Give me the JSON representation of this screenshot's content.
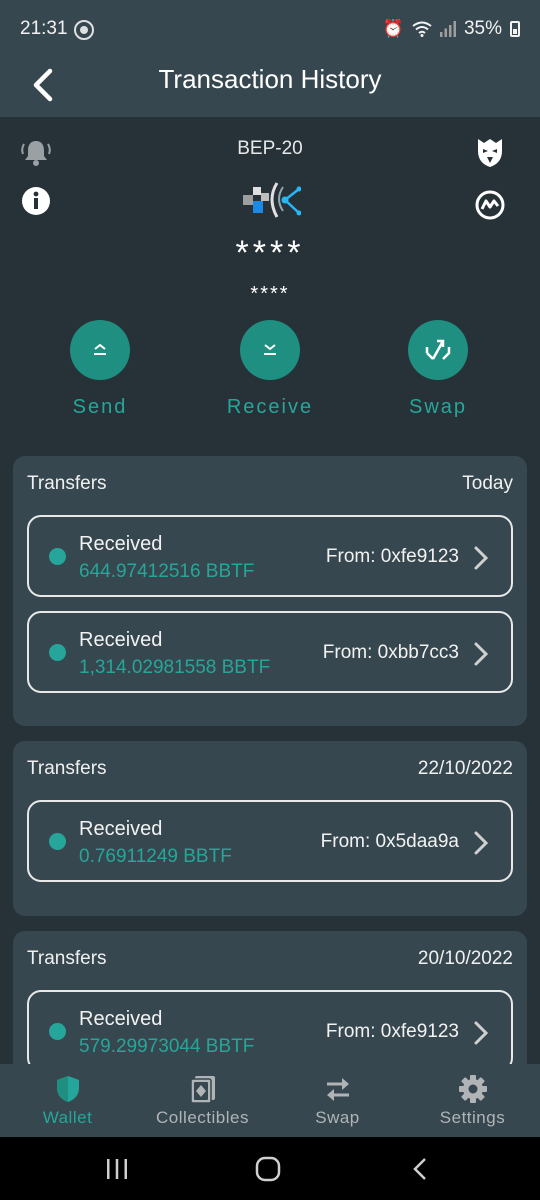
{
  "status_bar": {
    "time": "21:31",
    "battery": "35%"
  },
  "app_bar": {
    "title": "Transaction History"
  },
  "token": {
    "network": "BEP-20",
    "balance": "****",
    "balance_fiat": "****"
  },
  "actions": [
    {
      "label": "Send",
      "icon": "send-icon"
    },
    {
      "label": "Receive",
      "icon": "receive-icon"
    },
    {
      "label": "Swap",
      "icon": "swap-icon"
    }
  ],
  "groups": [
    {
      "title": "Transfers",
      "date": "Today",
      "items": [
        {
          "type": "Received",
          "amount": "644.97412516 BBTF",
          "from": "From: 0xfe9123"
        },
        {
          "type": "Received",
          "amount": "1,314.02981558 BBTF",
          "from": "From: 0xbb7cc3"
        }
      ]
    },
    {
      "title": "Transfers",
      "date": "22/10/2022",
      "items": [
        {
          "type": "Received",
          "amount": "0.76911249 BBTF",
          "from": "From: 0x5daa9a"
        }
      ]
    },
    {
      "title": "Transfers",
      "date": "20/10/2022",
      "items": [
        {
          "type": "Received",
          "amount": "579.29973044 BBTF",
          "from": "From: 0xfe9123"
        }
      ]
    }
  ],
  "bottom_nav": [
    {
      "label": "Wallet",
      "icon": "shield-icon",
      "active": true
    },
    {
      "label": "Collectibles",
      "icon": "collectibles-icon",
      "active": false
    },
    {
      "label": "Swap",
      "icon": "swap-arrows-icon",
      "active": false
    },
    {
      "label": "Settings",
      "icon": "gear-icon",
      "active": false
    }
  ],
  "colors": {
    "accent": "#26a69a",
    "background": "#263238",
    "surface": "#37474f"
  }
}
